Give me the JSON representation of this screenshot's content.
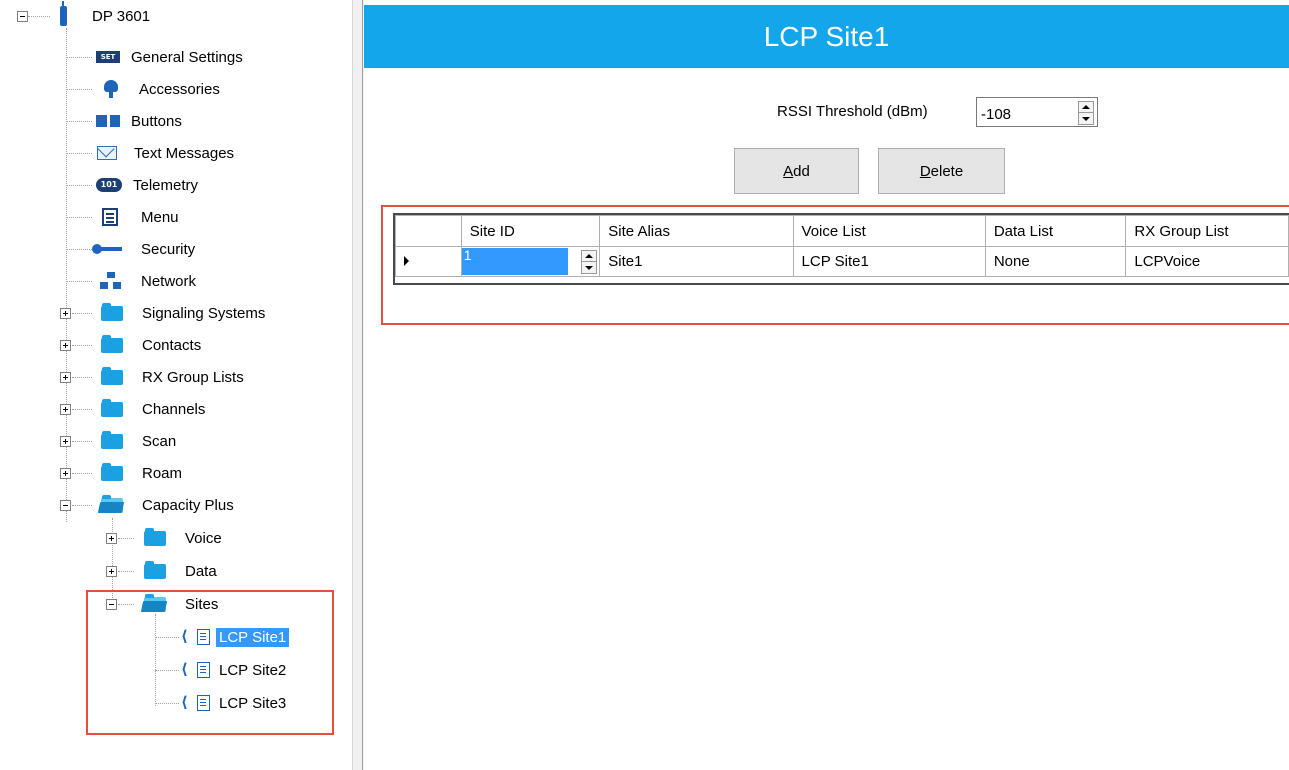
{
  "tree": {
    "root": "DP 3601",
    "items": [
      {
        "label": "General Settings",
        "icon": "settings-icon"
      },
      {
        "label": "Accessories",
        "icon": "accessory-icon"
      },
      {
        "label": "Buttons",
        "icon": "buttons-icon"
      },
      {
        "label": "Text Messages",
        "icon": "envelope-icon"
      },
      {
        "label": "Telemetry",
        "icon": "telemetry-icon"
      },
      {
        "label": "Menu",
        "icon": "menu-icon"
      },
      {
        "label": "Security",
        "icon": "key-icon"
      },
      {
        "label": "Network",
        "icon": "network-icon"
      },
      {
        "label": "Signaling Systems",
        "icon": "folder-icon"
      },
      {
        "label": "Contacts",
        "icon": "folder-icon"
      },
      {
        "label": "RX Group Lists",
        "icon": "folder-icon"
      },
      {
        "label": "Channels",
        "icon": "folder-icon"
      },
      {
        "label": "Scan",
        "icon": "folder-icon"
      },
      {
        "label": "Roam",
        "icon": "folder-icon"
      },
      {
        "label": "Capacity Plus",
        "icon": "open-folder-icon"
      }
    ],
    "capacity_plus": [
      {
        "label": "Voice",
        "icon": "folder-icon"
      },
      {
        "label": "Data",
        "icon": "folder-icon"
      },
      {
        "label": "Sites",
        "icon": "open-folder-icon"
      }
    ],
    "sites": [
      {
        "label": "LCP Site1",
        "selected": true
      },
      {
        "label": "LCP Site2",
        "selected": false
      },
      {
        "label": "LCP Site3",
        "selected": false
      }
    ],
    "settings_icon_text": "SET",
    "telemetry_icon_text": "101"
  },
  "content": {
    "title": "LCP Site1",
    "rssi_label": "RSSI Threshold (dBm)",
    "rssi_value": "-108",
    "add_prefix": "A",
    "add_rest": "dd",
    "delete_prefix": "D",
    "delete_rest": "elete",
    "grid": {
      "columns": [
        "Site ID",
        "Site Alias",
        "Voice List",
        "Data List",
        "RX Group List"
      ],
      "rows": [
        {
          "site_id": "1",
          "site_alias": "Site1",
          "voice_list": "LCP Site1",
          "data_list": "None",
          "rx_group_list": "LCPVoice"
        }
      ]
    }
  },
  "colors": {
    "header": "#13a6eb",
    "selection": "#3399ff",
    "highlight_box": "#e74c3c",
    "folder": "#1ba1e2"
  }
}
